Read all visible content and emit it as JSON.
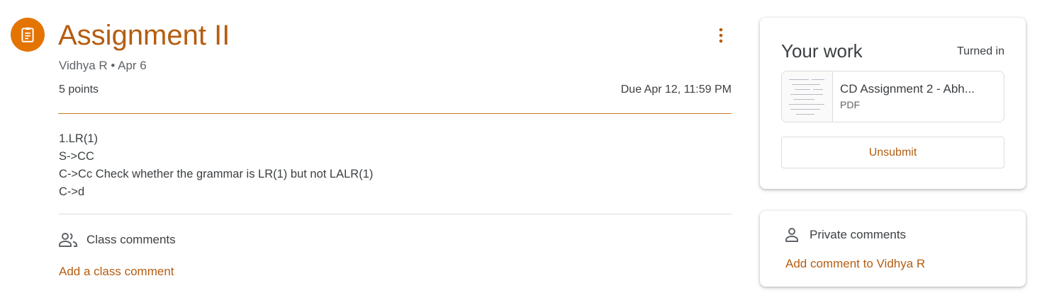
{
  "assignment": {
    "icon": "assignment-clipboard-icon",
    "title": "Assignment II",
    "meta": "Vidhya R • Apr 6",
    "points": "5 points",
    "due": "Due Apr 12, 11:59 PM",
    "more_icon": "more-vert-icon",
    "instructions": [
      "1.LR(1)",
      "S->CC",
      "C->Cc Check whether the grammar is LR(1) but not LALR(1)",
      "C->d"
    ]
  },
  "class_comments": {
    "icon": "people-icon",
    "label": "Class comments",
    "add_link": "Add a class comment"
  },
  "your_work": {
    "title": "Your work",
    "status": "Turned in",
    "attachment": {
      "name": "CD Assignment 2 - Abh...",
      "type": "PDF"
    },
    "unsubmit_label": "Unsubmit"
  },
  "private_comments": {
    "icon": "person-icon",
    "label": "Private comments",
    "add_link": "Add comment to Vidhya R"
  },
  "colors": {
    "accent": "#b55d11",
    "icon_bg": "#e37400",
    "divider_accent": "#c77a2a",
    "divider": "#dadce0"
  }
}
